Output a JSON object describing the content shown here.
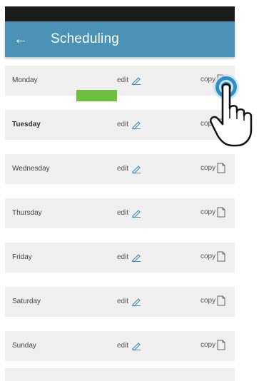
{
  "appbar": {
    "back_icon": "arrow-left-icon",
    "title": "Scheduling"
  },
  "days": [
    {
      "label": "Monday",
      "edit": "edit",
      "copy": "copy",
      "bold": false
    },
    {
      "label": "Tuesday",
      "edit": "edit",
      "copy": "copy",
      "bold": true
    },
    {
      "label": "Wednesday",
      "edit": "edit",
      "copy": "copy",
      "bold": false
    },
    {
      "label": "Thursday",
      "edit": "edit",
      "copy": "copy",
      "bold": false
    },
    {
      "label": "Friday",
      "edit": "edit",
      "copy": "copy",
      "bold": false
    },
    {
      "label": "Saturday",
      "edit": "edit",
      "copy": "copy",
      "bold": false
    },
    {
      "label": "Sunday",
      "edit": "edit",
      "copy": "copy",
      "bold": false
    }
  ],
  "icons": {
    "edit": "pencil-icon",
    "copy": "copy-icon",
    "pointer": "tap-hand-icon"
  },
  "colors": {
    "appbar": "#4a93b7",
    "statusbar": "#1c1c1c",
    "row_bg": "#efefef",
    "highlight_bar": "#6dbf3f",
    "pencil": "#4a93b7"
  }
}
